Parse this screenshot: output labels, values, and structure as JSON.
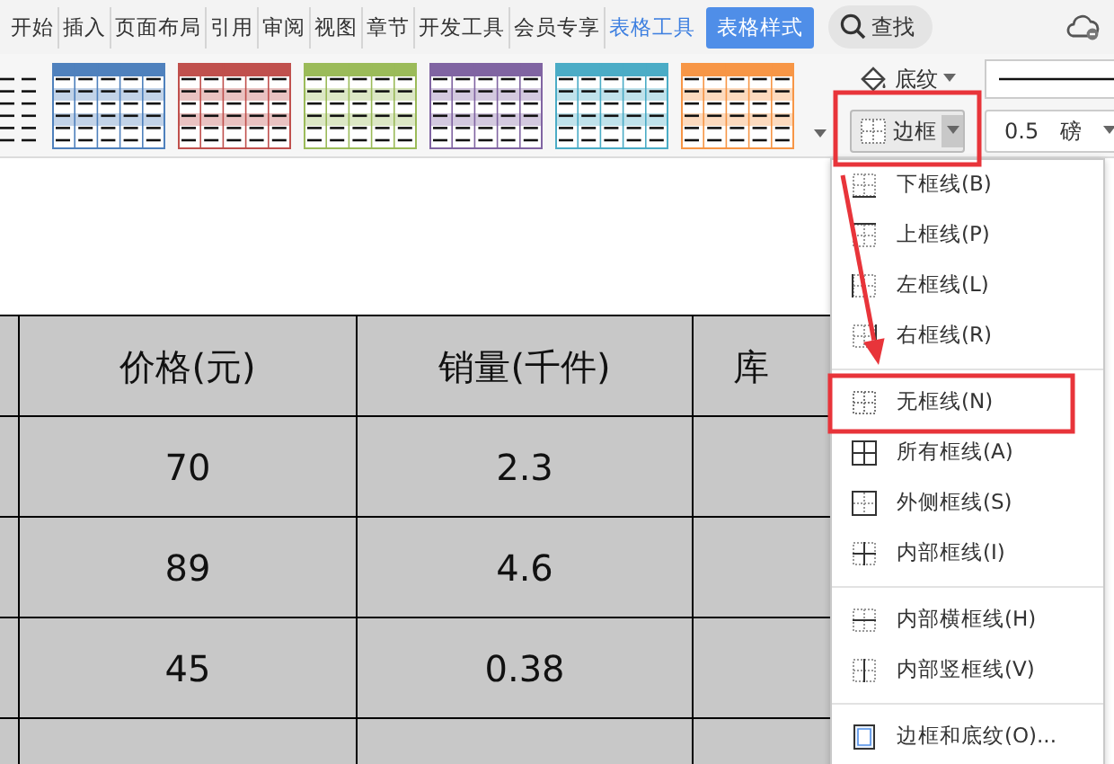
{
  "menu_tabs": [
    {
      "label": "开始",
      "kind": "tab",
      "selected": false
    },
    {
      "label": "插入",
      "kind": "tab",
      "selected": false
    },
    {
      "label": "页面布局",
      "kind": "tab",
      "selected": false
    },
    {
      "label": "引用",
      "kind": "tab",
      "selected": false
    },
    {
      "label": "审阅",
      "kind": "tab",
      "selected": false
    },
    {
      "label": "视图",
      "kind": "tab",
      "selected": false
    },
    {
      "label": "章节",
      "kind": "tab",
      "selected": false
    },
    {
      "label": "开发工具",
      "kind": "tab",
      "selected": false
    },
    {
      "label": "会员专享",
      "kind": "tab",
      "selected": false
    },
    {
      "label": "表格工具",
      "kind": "context",
      "selected": false
    },
    {
      "label": "表格样式",
      "kind": "context",
      "selected": true
    }
  ],
  "search": {
    "label": "查找"
  },
  "style_gallery": [
    {
      "kind": "plain"
    },
    {
      "kind": "colored",
      "color": "#4f81bd"
    },
    {
      "kind": "colored",
      "color": "#c0504d"
    },
    {
      "kind": "colored",
      "color": "#9bbb59"
    },
    {
      "kind": "colored",
      "color": "#8064a2"
    },
    {
      "kind": "colored",
      "color": "#4bacc6"
    },
    {
      "kind": "colored",
      "color": "#f79646"
    }
  ],
  "shading_button": {
    "label": "底纹"
  },
  "border_button": {
    "label": "边框",
    "highlighted": true
  },
  "line_width": {
    "value": "0.5",
    "unit": "磅"
  },
  "table": {
    "columns": [
      "价格(元)",
      "销量(千件)",
      "库"
    ],
    "rows": [
      [
        "70",
        "2.3"
      ],
      [
        "89",
        "4.6"
      ],
      [
        "45",
        "0.38"
      ]
    ]
  },
  "border_menu": [
    [
      {
        "label": "下框线(B)",
        "kind": "bottom",
        "highlighted": false
      },
      {
        "label": "上框线(P)",
        "kind": "top",
        "highlighted": false
      },
      {
        "label": "左框线(L)",
        "kind": "left",
        "highlighted": false
      },
      {
        "label": "右框线(R)",
        "kind": "right",
        "highlighted": false
      }
    ],
    [
      {
        "label": "无框线(N)",
        "kind": "none",
        "highlighted": true
      },
      {
        "label": "所有框线(A)",
        "kind": "all",
        "highlighted": false
      },
      {
        "label": "外侧框线(S)",
        "kind": "outside",
        "highlighted": false
      },
      {
        "label": "内部框线(I)",
        "kind": "inside",
        "highlighted": false
      }
    ],
    [
      {
        "label": "内部横框线(H)",
        "kind": "inside-h",
        "highlighted": false
      },
      {
        "label": "内部竖框线(V)",
        "kind": "inside-v",
        "highlighted": false
      }
    ],
    [
      {
        "label": "边框和底纹(O)...",
        "kind": "dialog",
        "highlighted": false
      }
    ]
  ],
  "annotation": {
    "arrow": true
  }
}
